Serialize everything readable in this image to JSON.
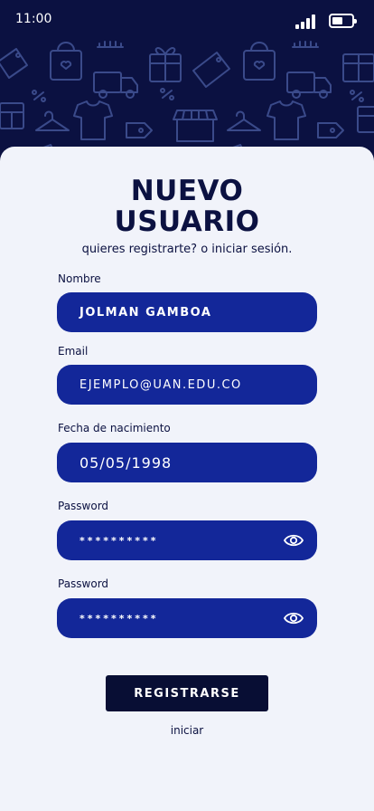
{
  "status_bar": {
    "time": "11:00",
    "signal_icon": "signal-icon",
    "battery_icon": "battery-icon"
  },
  "header": {
    "pattern_icons": [
      "tag-icon",
      "bag-icon",
      "truck-icon",
      "gift-icon",
      "percent-icon",
      "hanger-icon",
      "shirt-icon",
      "store-icon",
      "basket-icon"
    ]
  },
  "form": {
    "title_line1": "NUEVO",
    "title_line2": "USUARIO",
    "subtitle": "quieres registrarte? o iniciar sesión.",
    "fields": {
      "nombre": {
        "label": "Nombre",
        "value": "JOLMAN GAMBOA"
      },
      "email": {
        "label": "Email",
        "value": "EJEMPLO@UAN.EDU.CO"
      },
      "fecha": {
        "label": "Fecha de nacimiento",
        "value": "05/05/1998"
      },
      "password": {
        "label": "Password",
        "value": "**********",
        "toggle_icon": "eye-icon"
      },
      "password_confirm": {
        "label": "Password",
        "value": "**********",
        "toggle_icon": "eye-icon"
      }
    },
    "submit_label": "REGISTRARSE",
    "login_link": "iniciar"
  },
  "colors": {
    "header_bg": "#0b1141",
    "card_bg": "#f1f3fa",
    "field_bg": "#132799",
    "button_bg": "#080e34",
    "text_dark": "#0b1141"
  }
}
